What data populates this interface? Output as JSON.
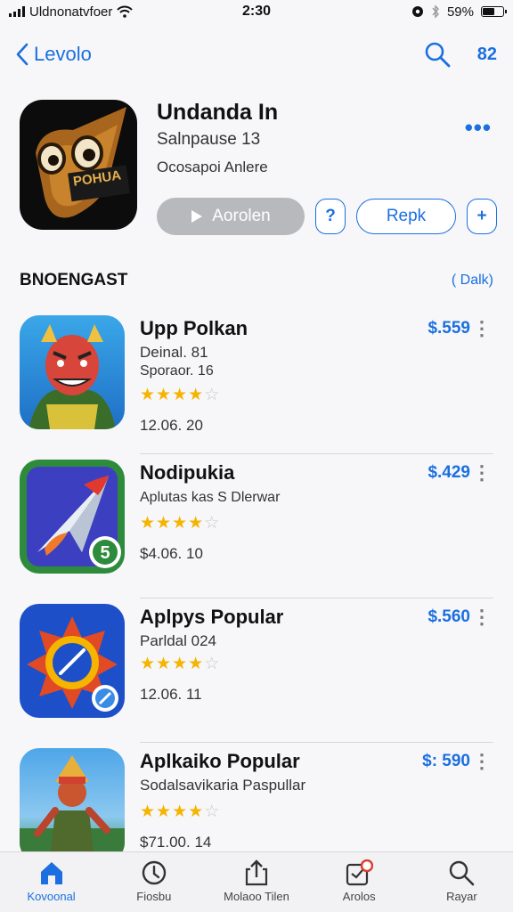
{
  "status_bar": {
    "carrier": "Uldnonatvfoer",
    "time": "2:30",
    "battery": "59%",
    "battery_level": 0.59,
    "icons": [
      "signal-icon",
      "wifi-icon",
      "alarm-icon",
      "bluetooth-icon",
      "battery-icon"
    ]
  },
  "nav": {
    "back_label": "Levolo",
    "count": "82",
    "icons": [
      "chevron-left-icon",
      "search-icon"
    ]
  },
  "app": {
    "title": "Undanda In",
    "subtitle": "Salnpause 13",
    "developer": "Ocosapoi Anlere",
    "icon_text": "POHUA",
    "play_label": "Aorolen",
    "small_button_label": "?",
    "rate_button_label": "Repk",
    "add_button_label": "+",
    "more_label": "•••"
  },
  "section": {
    "title": "BNOENGAST",
    "link": "( Dalk)"
  },
  "apps": [
    {
      "title": "Upp Polkan",
      "line1": "Deinal. 81",
      "line2": "Sporaor. 16",
      "rating": 4,
      "date": "12.06. 20",
      "price": "$.559",
      "icon": "red-mask-character-icon"
    },
    {
      "title": "Nodipukia",
      "line1": "",
      "line2": "Aplutas kas S Dlerwar",
      "rating": 4,
      "date": "$4.06. 10",
      "price": "$.429",
      "icon": "paper-plane-icon"
    },
    {
      "title": "Aplpys Popular",
      "line1": "Parldal 024",
      "line2": "",
      "rating": 4,
      "date": "12.06. 11",
      "price": "$.560",
      "icon": "compass-sun-icon"
    },
    {
      "title": "Aplkaiko Popular",
      "line1": "Sodalsavikaria Paspullar",
      "line2": "",
      "rating": 4,
      "date": "$71.00. 14",
      "price": "$: 590",
      "icon": "warrior-character-icon"
    }
  ],
  "tabs": [
    {
      "label": "Kovoonal",
      "icon": "home-icon",
      "active": true
    },
    {
      "label": "Fiosbu",
      "icon": "compass-icon",
      "active": false
    },
    {
      "label": "Molaoo Tilen",
      "icon": "share-icon",
      "active": false
    },
    {
      "label": "Arolos",
      "icon": "calendar-icon",
      "active": false
    },
    {
      "label": "Rayar",
      "icon": "search-icon",
      "active": false
    }
  ],
  "colors": {
    "accent": "#1b6fe0",
    "star": "#f5b400",
    "background": "#f7f7f9"
  }
}
